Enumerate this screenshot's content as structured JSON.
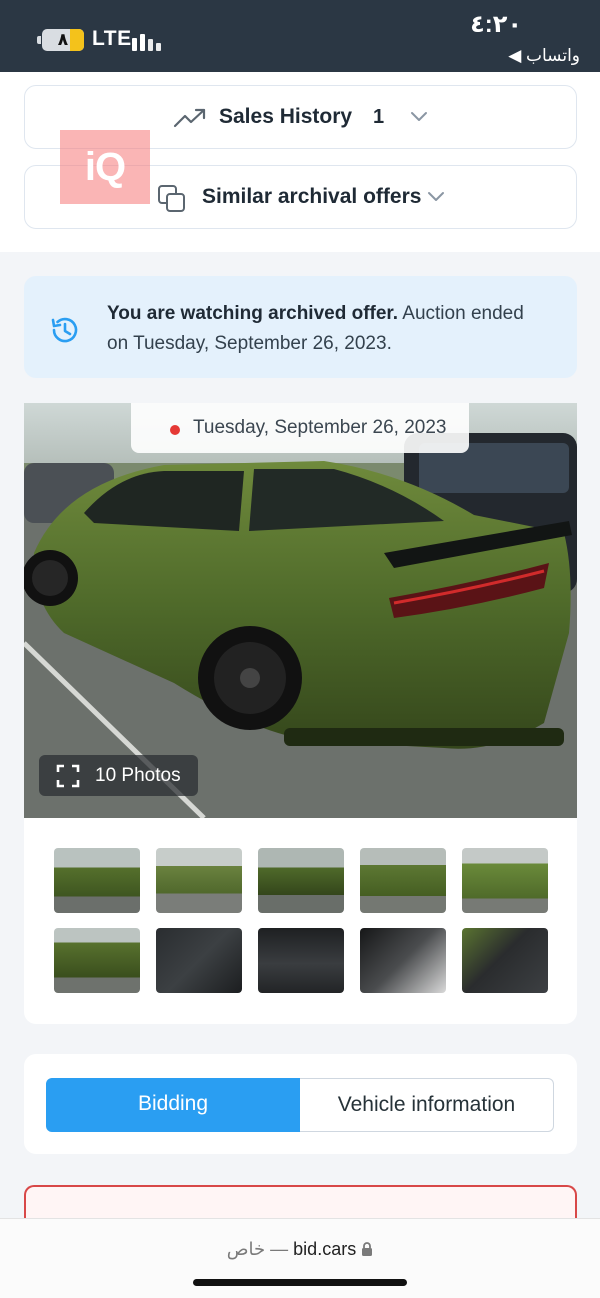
{
  "status_bar": {
    "battery_level": "٨",
    "network": "LTE",
    "time": "٤:٢٠",
    "back_app": "◀ واتساب"
  },
  "sales_history": {
    "label": "Sales History",
    "count": "1"
  },
  "similar_offers": {
    "label": "Similar archival offers"
  },
  "watermark": {
    "text": "iQ"
  },
  "notice": {
    "bold": "You are watching archived offer.",
    "rest": " Auction ended on Tuesday, September 26, 2023."
  },
  "gallery": {
    "date": "Tuesday, September 26, 2023",
    "photos_label": "10 Photos",
    "thumbnails": [
      "rear-left exterior",
      "left side",
      "rear-right",
      "front-right",
      "front",
      "rear",
      "driver seat",
      "dashboard",
      "center console",
      "rear seats"
    ]
  },
  "tabs": {
    "bidding": "Bidding",
    "vehicle_information": "Vehicle information"
  },
  "browser": {
    "private_label": "خاص —",
    "domain": "bid.cars"
  },
  "colors": {
    "accent": "#2a9ef2",
    "notice_bg": "#e4f1fc",
    "alert_red": "#d84848",
    "car_green": "#4f6a2a"
  }
}
